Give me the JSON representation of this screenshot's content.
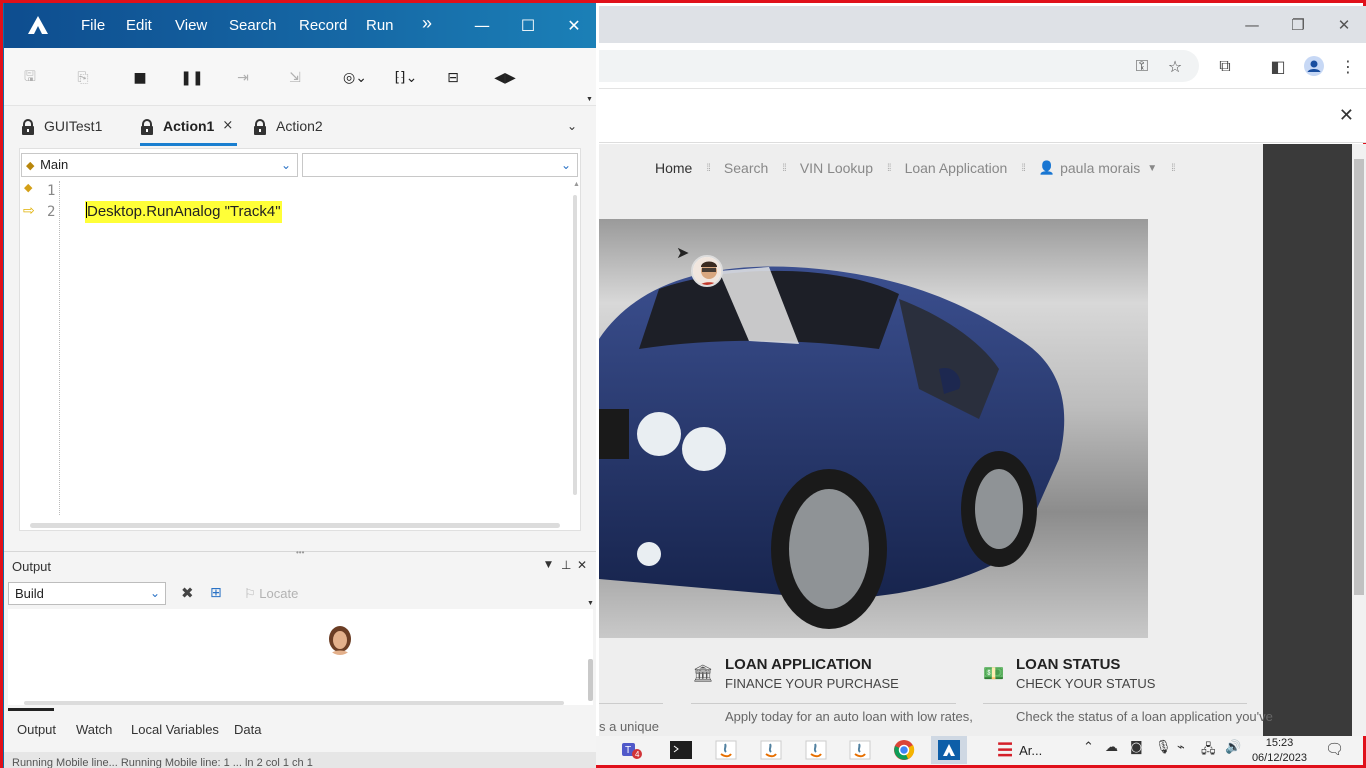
{
  "uft": {
    "menu": [
      "File",
      "Edit",
      "View",
      "Search",
      "Record",
      "Run"
    ],
    "more_menu_glyph": "»",
    "tabs": [
      {
        "label": "GUITest1"
      },
      {
        "label": "Action1",
        "close": "×"
      },
      {
        "label": "Action2"
      }
    ],
    "editor": {
      "scope_combo": "Main",
      "object_combo": "",
      "line_numbers": [
        "1",
        "2"
      ],
      "code_line": "Desktop.RunAnalog \"Track4\""
    },
    "output": {
      "title": "Output",
      "filter_value": "Build",
      "locate_label": "Locate",
      "bottom_tabs": [
        "Output",
        "Watch",
        "Local Variables",
        "Data"
      ]
    },
    "status_text": "Running Mobile line...   Running Mobile line: 1          ... ln 2     col 1   ch 1"
  },
  "browser": {
    "nav": [
      "Home",
      "Search",
      "VIN Lookup",
      "Loan Application",
      "paula morais"
    ],
    "sections": [
      {
        "title": "LOAN APPLICATION",
        "subtitle": "FINANCE YOUR PURCHASE",
        "description": "Apply today for an auto loan with low rates,"
      },
      {
        "title": "LOAN STATUS",
        "subtitle": "CHECK YOUR STATUS",
        "description": "Check the status of a loan application you've"
      }
    ],
    "partial_text": "s a unique"
  },
  "taskbar": {
    "app_label": "Ar...",
    "badge_count": "4",
    "time": "15:23",
    "date": "06/12/2023"
  },
  "colors": {
    "uft_title_start": "#0e4d8f",
    "uft_title_end": "#1b80b7",
    "highlight": "#ffff38",
    "tab_underline": "#1a7fd0",
    "frame_red": "#e0101a"
  }
}
